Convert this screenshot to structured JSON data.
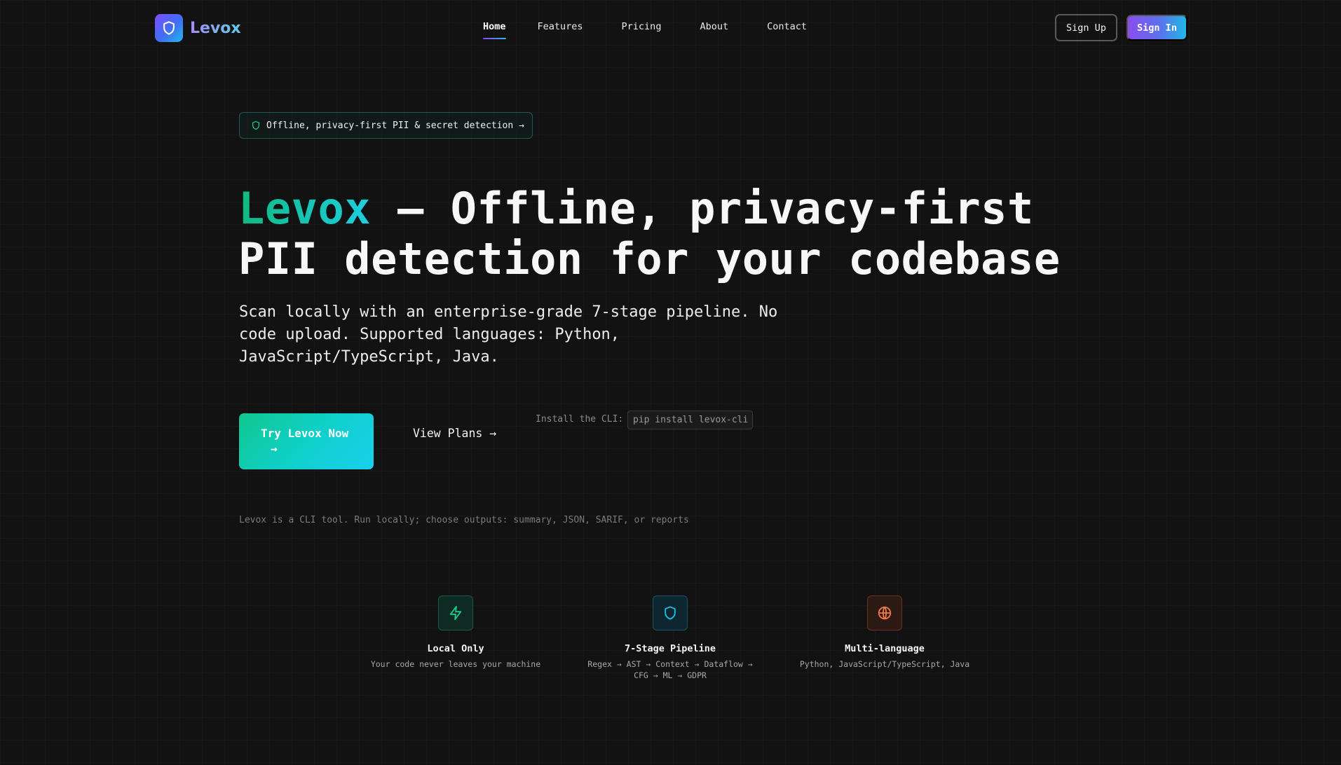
{
  "brand": {
    "name": "Levox"
  },
  "nav": {
    "items": [
      {
        "label": "Home",
        "active": true
      },
      {
        "label": "Features",
        "active": false
      },
      {
        "label": "Pricing",
        "active": false
      },
      {
        "label": "About",
        "active": false
      },
      {
        "label": "Contact",
        "active": false
      }
    ]
  },
  "auth": {
    "signup_label": "Sign Up",
    "signin_label": "Sign In"
  },
  "badge": {
    "text": "Offline, privacy-first PII & secret detection →"
  },
  "hero": {
    "brand_word": "Levox",
    "title_rest_line1": " — Offline, privacy-first",
    "title_line2": "PII detection for your codebase",
    "subtitle": "Scan locally with an enterprise-grade 7-stage pipeline. No code upload. Supported languages: Python, JavaScript/TypeScript, Java."
  },
  "cta": {
    "try_label": "Try Levox Now",
    "try_arrow": "→",
    "plans_label": "View Plans →"
  },
  "cli": {
    "label": "Install the CLI:",
    "command": "pip install levox-cli"
  },
  "note": "Levox is a CLI tool. Run locally; choose outputs: summary, JSON, SARIF, or reports",
  "features": [
    {
      "icon": "lightning-icon",
      "title": "Local Only",
      "desc": "Your code never leaves your machine",
      "color": "#1ec98a"
    },
    {
      "icon": "shield-icon",
      "title": "7-Stage Pipeline",
      "desc": "Regex → AST → Context → Dataflow → CFG → ML → GDPR",
      "color": "#1cc0e8"
    },
    {
      "icon": "globe-icon",
      "title": "Multi-language",
      "desc": "Python, JavaScript/TypeScript, Java",
      "color": "#f07a4a"
    }
  ],
  "colors": {
    "background": "#121212",
    "accent_green": "#10b981",
    "accent_cyan": "#1ecfe0",
    "accent_purple": "#8b4dee"
  }
}
